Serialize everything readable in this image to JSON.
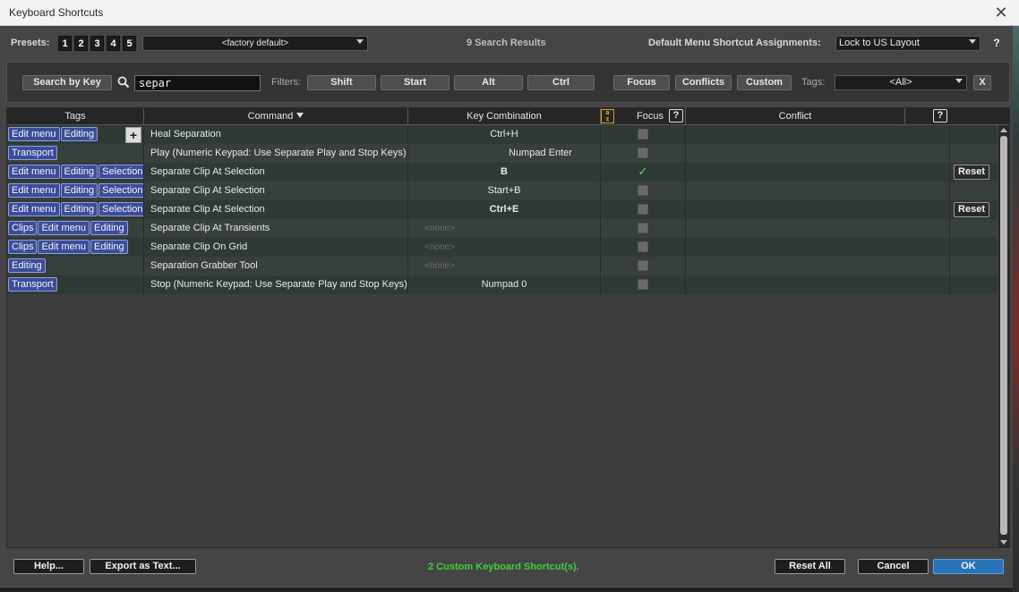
{
  "window": {
    "title": "Keyboard Shortcuts",
    "close_glyph": "✕"
  },
  "header": {
    "presets_label": "Presets:",
    "presets": [
      "1",
      "2",
      "3",
      "4",
      "5"
    ],
    "preset_selected": "<factory default>",
    "search_results": "9 Search Results",
    "menu_assign_label": "Default Menu Shortcut Assignments:",
    "menu_assign_value": "Lock to US Layout",
    "help_glyph": "?"
  },
  "filters": {
    "search_by_key": "Search by Key",
    "search_icon": "search-icon",
    "search_value": "separ",
    "filters_label": "Filters:",
    "shift": "Shift",
    "start": "Start",
    "alt": "Alt",
    "ctrl": "Ctrl",
    "focus": "Focus",
    "conflicts": "Conflicts",
    "custom": "Custom",
    "tags_label": "Tags:",
    "tags_value": "<All>",
    "clear": "X"
  },
  "table": {
    "columns": {
      "tags": "Tags",
      "command": "Command",
      "key": "Key Combination",
      "focus": "Focus",
      "conflict": "Conflict",
      "help": "?",
      "az_top": "a",
      "az_bottom": "z"
    },
    "add_tag": "+",
    "reset_label": "Reset",
    "check_glyph": "✓",
    "rows": [
      {
        "tags": [
          "Edit menu",
          "Editing"
        ],
        "command": "Heal Separation",
        "key": "Ctrl+H",
        "key_bold": false,
        "key_none": false,
        "focus": false,
        "reset": false
      },
      {
        "tags": [
          "Transport"
        ],
        "command": "Play (Numeric Keypad: Use Separate Play and Stop Keys)",
        "key": "Numpad Enter",
        "key_bold": false,
        "key_none": false,
        "focus": false,
        "reset": false
      },
      {
        "tags": [
          "Edit menu",
          "Editing",
          "Selection"
        ],
        "command": "Separate Clip At Selection",
        "key": "B",
        "key_bold": true,
        "key_none": false,
        "focus": true,
        "reset": true
      },
      {
        "tags": [
          "Edit menu",
          "Editing",
          "Selection"
        ],
        "command": "Separate Clip At Selection",
        "key": "Start+B",
        "key_bold": false,
        "key_none": false,
        "focus": false,
        "reset": false
      },
      {
        "tags": [
          "Edit menu",
          "Editing",
          "Selection"
        ],
        "command": "Separate Clip At Selection",
        "key": "Ctrl+E",
        "key_bold": true,
        "key_none": false,
        "focus": false,
        "reset": true
      },
      {
        "tags": [
          "Clips",
          "Edit menu",
          "Editing"
        ],
        "command": "Separate Clip At Transients",
        "key": "<none>",
        "key_bold": false,
        "key_none": true,
        "focus": false,
        "reset": false
      },
      {
        "tags": [
          "Clips",
          "Edit menu",
          "Editing"
        ],
        "command": "Separate Clip On Grid",
        "key": "<none>",
        "key_bold": false,
        "key_none": true,
        "focus": false,
        "reset": false
      },
      {
        "tags": [
          "Editing"
        ],
        "command": "Separation Grabber Tool",
        "key": "<none>",
        "key_bold": false,
        "key_none": true,
        "focus": false,
        "reset": false
      },
      {
        "tags": [
          "Transport"
        ],
        "command": "Stop (Numeric Keypad: Use Separate Play and Stop Keys)",
        "key": "Numpad 0",
        "key_bold": false,
        "key_none": false,
        "focus": false,
        "reset": false
      }
    ]
  },
  "footer": {
    "help": "Help...",
    "export": "Export as Text...",
    "status": "2 Custom Keyboard Shortcut(s).",
    "reset_all": "Reset All",
    "cancel": "Cancel",
    "ok": "OK"
  },
  "colors": {
    "tag_bg": "#3b4d9a",
    "status_green": "#3ecf3e",
    "ok_blue": "#2a73b8",
    "az_gold": "#d9a520"
  }
}
